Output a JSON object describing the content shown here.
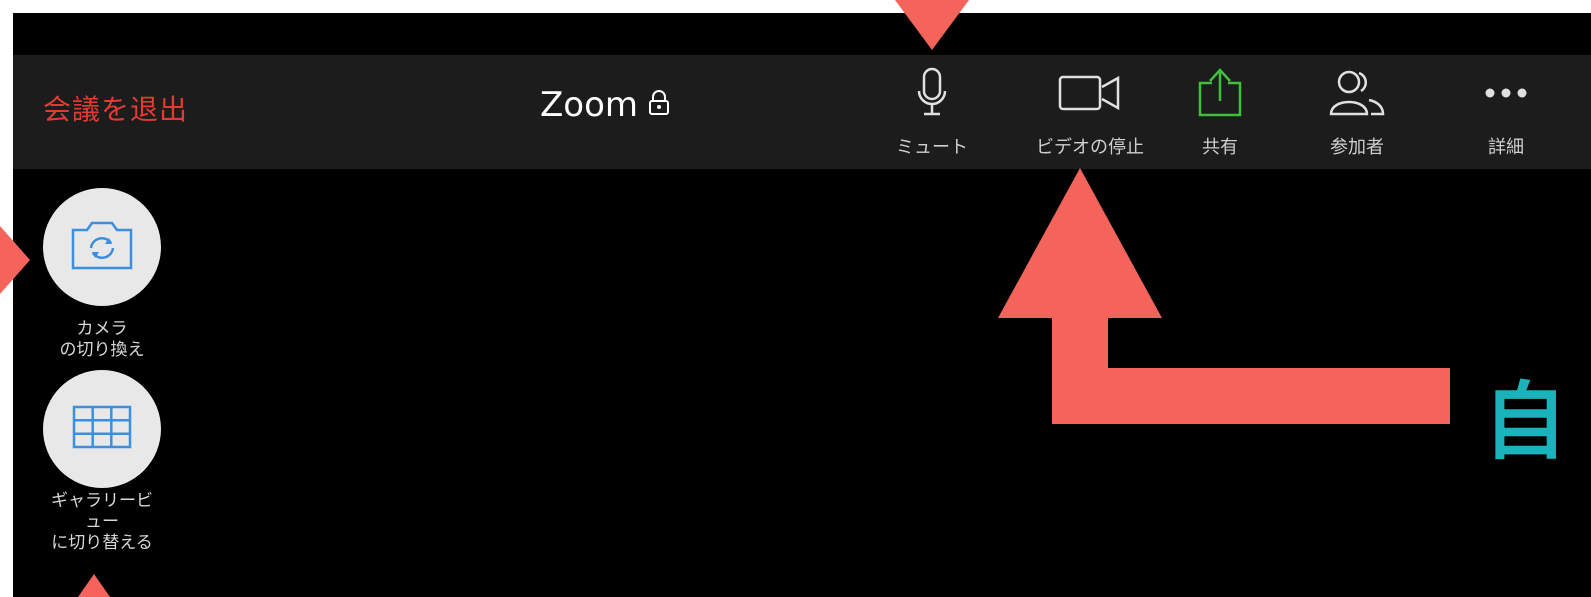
{
  "toolbar": {
    "leave_label": "会議を退出",
    "title": "Zoom",
    "lock_icon": "lock-icon",
    "tools": [
      {
        "label": "ミュート",
        "icon": "microphone-icon"
      },
      {
        "label": "ビデオの停止",
        "icon": "video-camera-icon"
      },
      {
        "label": "共有",
        "icon": "share-icon"
      },
      {
        "label": "参加者",
        "icon": "participants-icon"
      },
      {
        "label": "詳細",
        "icon": "more-icon"
      }
    ]
  },
  "side": {
    "switch_camera_label_1": "カメラ",
    "switch_camera_label_2": "の切り換え",
    "gallery_label_1": "ギャラリービ",
    "gallery_label_2": "ュー",
    "gallery_label_3": "に切り替える"
  },
  "annotation": {
    "text": "自",
    "arrow_color": "#f4645a",
    "text_color": "#1ab3bb"
  },
  "colors": {
    "leave": "#e23b32",
    "share_green": "#3fbf3a",
    "toolbar_bg": "#1c1c1c",
    "icon_blue": "#3a8fe0"
  }
}
